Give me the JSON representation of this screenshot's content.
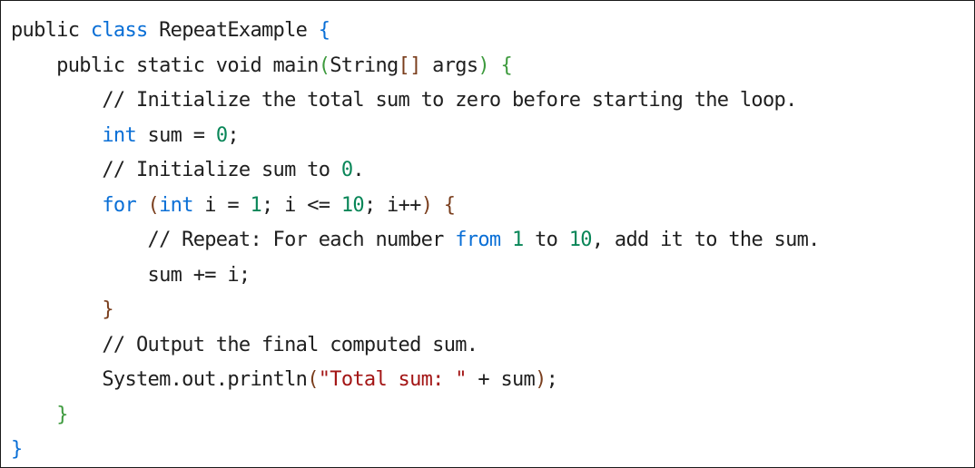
{
  "code_block": {
    "colors": {
      "plain": "#1f1f1f",
      "keyword": "#0a6fd6",
      "brace_outer": "#0a6fd6",
      "brace_method": "#3d9a3d",
      "brace_loop": "#7a3e1d",
      "comment": "#1f1f1f",
      "string": "#a31515",
      "number": "#098658"
    },
    "lines": [
      {
        "tokens": [
          {
            "t": "public ",
            "c": "plain"
          },
          {
            "t": "class",
            "c": "keyword"
          },
          {
            "t": " RepeatExample ",
            "c": "plain"
          },
          {
            "t": "{",
            "c": "brace_outer"
          }
        ]
      },
      {
        "tokens": [
          {
            "t": "    public static void main",
            "c": "plain"
          },
          {
            "t": "(",
            "c": "brace_method"
          },
          {
            "t": "String",
            "c": "plain"
          },
          {
            "t": "[]",
            "c": "brace_loop"
          },
          {
            "t": " args",
            "c": "plain"
          },
          {
            "t": ") {",
            "c": "brace_method"
          }
        ]
      },
      {
        "tokens": [
          {
            "t": "        // Initialize the total sum to zero before starting the loop.",
            "c": "comment"
          }
        ]
      },
      {
        "tokens": [
          {
            "t": "        ",
            "c": "plain"
          },
          {
            "t": "int",
            "c": "keyword"
          },
          {
            "t": " sum = ",
            "c": "plain"
          },
          {
            "t": "0",
            "c": "number"
          },
          {
            "t": ";",
            "c": "plain"
          }
        ]
      },
      {
        "tokens": [
          {
            "t": "        // Initialize sum to ",
            "c": "comment"
          },
          {
            "t": "0",
            "c": "number"
          },
          {
            "t": ".",
            "c": "comment"
          }
        ]
      },
      {
        "tokens": [
          {
            "t": "        ",
            "c": "plain"
          },
          {
            "t": "for",
            "c": "keyword"
          },
          {
            "t": " (",
            "c": "brace_loop"
          },
          {
            "t": "int",
            "c": "keyword"
          },
          {
            "t": " i = ",
            "c": "plain"
          },
          {
            "t": "1",
            "c": "number"
          },
          {
            "t": "; i <= ",
            "c": "plain"
          },
          {
            "t": "10",
            "c": "number"
          },
          {
            "t": "; i++",
            "c": "plain"
          },
          {
            "t": ") {",
            "c": "brace_loop"
          }
        ]
      },
      {
        "tokens": [
          {
            "t": "            // Repeat: For each number ",
            "c": "comment"
          },
          {
            "t": "from",
            "c": "keyword"
          },
          {
            "t": " ",
            "c": "comment"
          },
          {
            "t": "1",
            "c": "number"
          },
          {
            "t": " to ",
            "c": "comment"
          },
          {
            "t": "10",
            "c": "number"
          },
          {
            "t": ", add it to the sum.",
            "c": "comment"
          }
        ]
      },
      {
        "tokens": [
          {
            "t": "            sum += i;",
            "c": "plain"
          }
        ]
      },
      {
        "tokens": [
          {
            "t": "        ",
            "c": "plain"
          },
          {
            "t": "}",
            "c": "brace_loop"
          }
        ]
      },
      {
        "tokens": [
          {
            "t": "        // Output the final computed sum.",
            "c": "comment"
          }
        ]
      },
      {
        "tokens": [
          {
            "t": "        System.out.println",
            "c": "plain"
          },
          {
            "t": "(",
            "c": "brace_loop"
          },
          {
            "t": "\"Total sum: \"",
            "c": "string"
          },
          {
            "t": " + sum",
            "c": "plain"
          },
          {
            "t": ")",
            "c": "brace_loop"
          },
          {
            "t": ";",
            "c": "plain"
          }
        ]
      },
      {
        "tokens": [
          {
            "t": "    ",
            "c": "plain"
          },
          {
            "t": "}",
            "c": "brace_method"
          }
        ]
      },
      {
        "tokens": [
          {
            "t": "}",
            "c": "brace_outer"
          }
        ]
      }
    ]
  }
}
